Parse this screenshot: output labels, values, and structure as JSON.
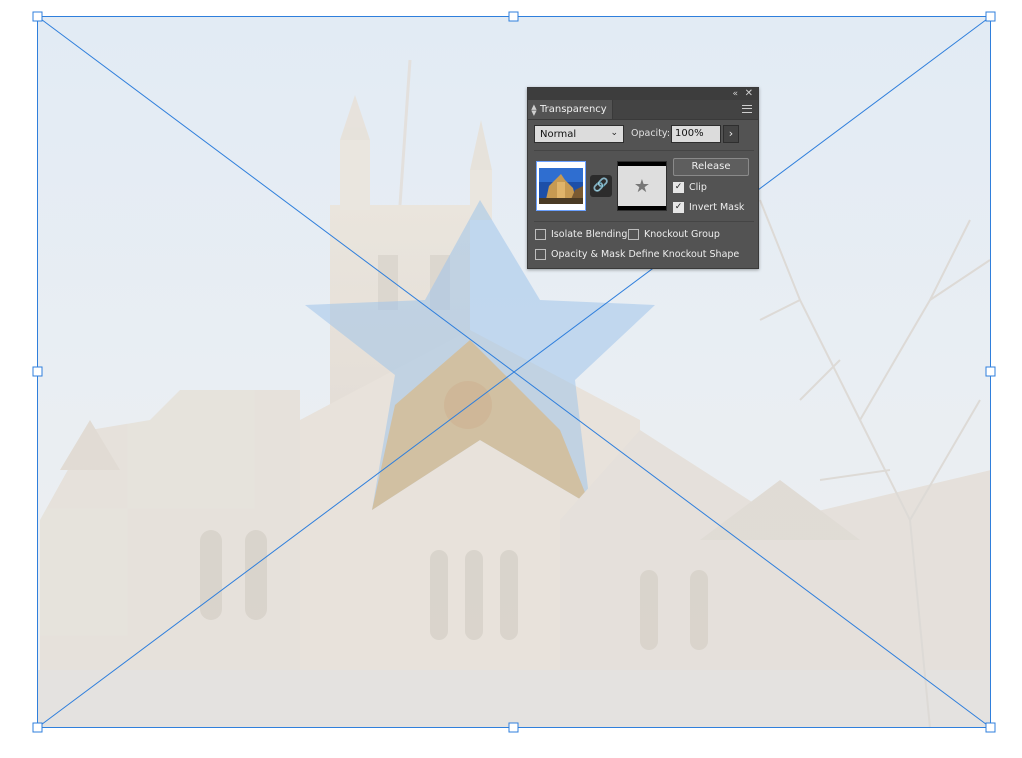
{
  "panel": {
    "title": "Transparency",
    "collapse_icon": "«",
    "close_icon": "✕",
    "menu_icon": "panel-menu-icon",
    "blend_mode": "Normal",
    "opacity_label": "Opacity:",
    "opacity_value": "100%",
    "opacity_arrow": "›",
    "release_label": "Release",
    "clip_label": "Clip",
    "clip_checked": true,
    "invert_mask_label": "Invert Mask",
    "invert_mask_checked": true,
    "isolate_blending_label": "Isolate Blending",
    "isolate_blending_checked": false,
    "knockout_group_label": "Knockout Group",
    "knockout_group_checked": false,
    "opacity_mask_label": "Opacity & Mask Define Knockout Shape",
    "opacity_mask_checked": false
  },
  "colors": {
    "selection": "#2f7fdc",
    "panel_bg": "#535353",
    "star": "#6fa6de"
  }
}
